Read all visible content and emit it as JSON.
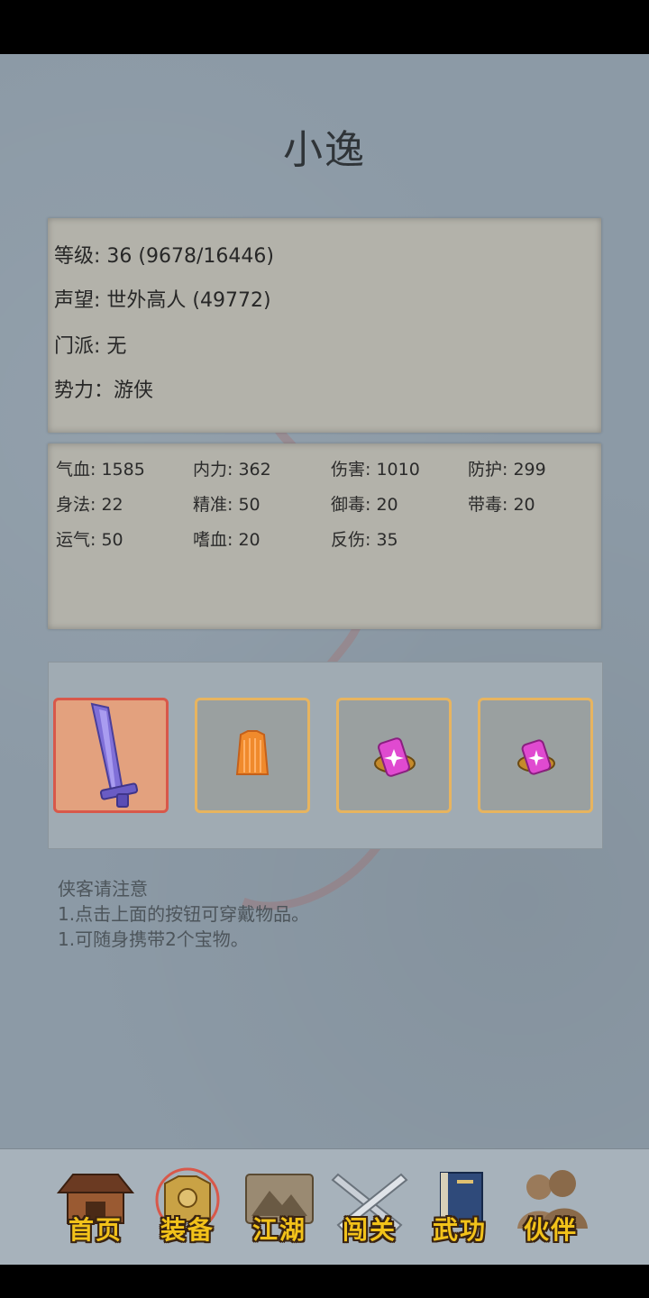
{
  "character": {
    "name": "小逸",
    "info": {
      "level": "等级: 36 (9678/16446)",
      "prestige": "声望: 世外高人 (49772)",
      "sect": "门派: 无",
      "faction": "势力：游侠"
    }
  },
  "stats": [
    "气血: 1585",
    "内力: 362",
    "伤害: 1010",
    "防护: 299",
    "身法: 22",
    "精准: 50",
    "御毒: 20",
    "带毒: 20",
    "运气: 50",
    "嗜血: 20",
    "反伤: 35"
  ],
  "equipment": {
    "slots": [
      {
        "item": "sword-icon",
        "selected": true
      },
      {
        "item": "armor-icon",
        "selected": false
      },
      {
        "item": "treasure-icon",
        "selected": false
      },
      {
        "item": "treasure-icon",
        "selected": false
      }
    ]
  },
  "notes": {
    "title": "侠客请注意",
    "line1": "1.点击上面的按钮可穿戴物品。",
    "line2": "1.可随身携带2个宝物。"
  },
  "nav": {
    "items": [
      {
        "label": "首页",
        "icon": "house-icon"
      },
      {
        "label": "装备",
        "icon": "armor-icon"
      },
      {
        "label": "江湖",
        "icon": "scroll-map-icon"
      },
      {
        "label": "闯关",
        "icon": "crossed-swords-icon"
      },
      {
        "label": "武功",
        "icon": "book-icon"
      },
      {
        "label": "伙伴",
        "icon": "companions-icon"
      }
    ],
    "active": "装备"
  },
  "colors": {
    "background": "#8c9aa6",
    "panel": "#b3b2aa",
    "slot_border": "#e7b45f",
    "selected_slot_border": "#d8584a",
    "nav_label": "#f2c21a"
  }
}
